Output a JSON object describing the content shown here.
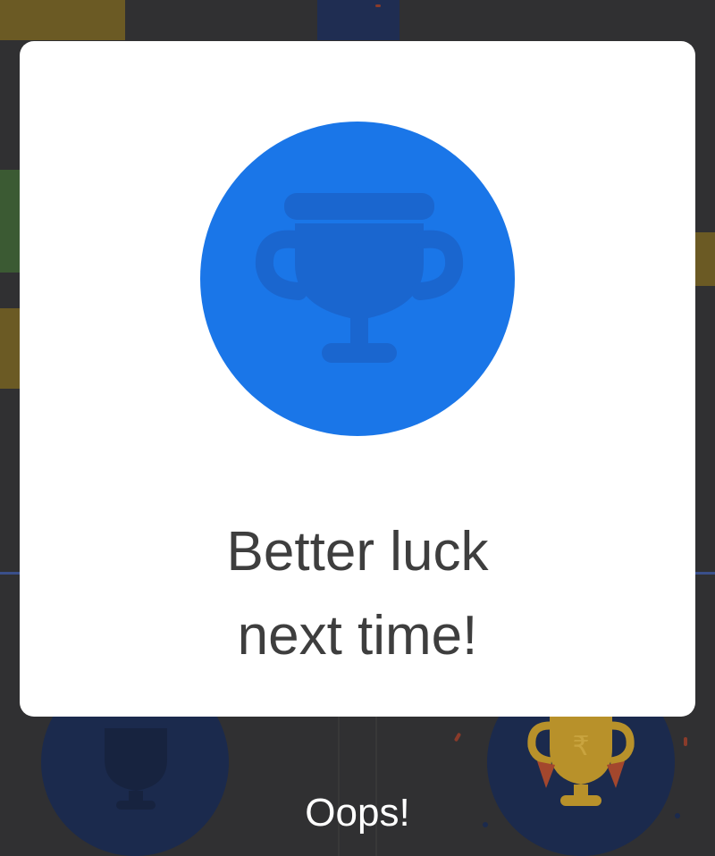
{
  "popup": {
    "icon": "trophy-icon",
    "message_line1": "Better luck",
    "message_line2": "next time!",
    "accent_color": "#1a76e8"
  },
  "background": {
    "title": "Oops!",
    "trophy_color": "#b8912a",
    "circle_color": "#1b2a4d"
  }
}
